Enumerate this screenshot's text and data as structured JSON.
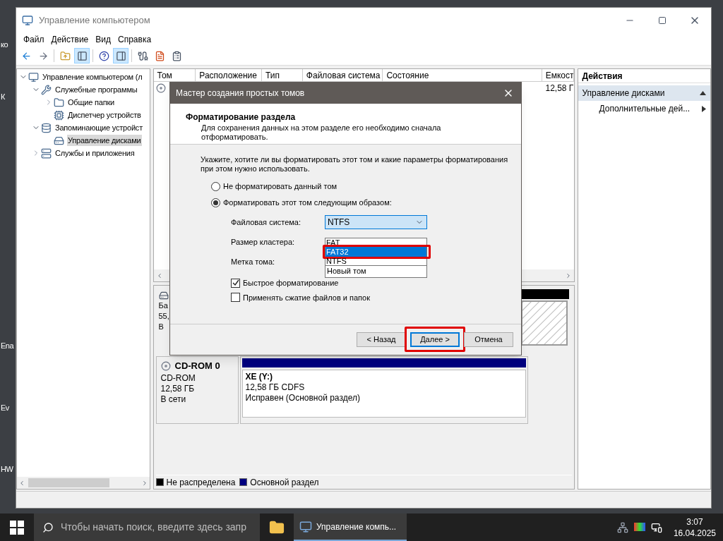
{
  "desktop": {
    "icon_labels": [
      "ко",
      "К",
      "Ena",
      "Ev",
      "HW"
    ]
  },
  "window": {
    "title": "Управление компьютером",
    "menu": [
      "Файл",
      "Действие",
      "Вид",
      "Справка"
    ],
    "toolbar": [
      {
        "kind": "back",
        "pressed": false
      },
      {
        "kind": "forward",
        "pressed": false
      },
      {
        "kind": "separator"
      },
      {
        "kind": "up",
        "pressed": false
      },
      {
        "kind": "tree",
        "pressed": true
      },
      {
        "kind": "separator"
      },
      {
        "kind": "help",
        "pressed": false
      },
      {
        "kind": "actions",
        "pressed": true
      },
      {
        "kind": "separator"
      },
      {
        "kind": "connect",
        "pressed": false
      },
      {
        "kind": "check",
        "pressed": false
      },
      {
        "kind": "list",
        "pressed": false
      }
    ],
    "tree": [
      {
        "label": "Управление компьютером (л",
        "kind": "computer",
        "expanded": true,
        "selected": false,
        "children": [
          {
            "label": "Служебные программы",
            "kind": "tools",
            "expanded": true,
            "selected": false,
            "children": [
              {
                "label": "Общие папки",
                "kind": "folder",
                "expanded": false,
                "selected": false
              },
              {
                "label": "Диспетчер устройств",
                "kind": "device",
                "selected": false
              }
            ]
          },
          {
            "label": "Запоминающие устройст",
            "kind": "storage",
            "expanded": true,
            "selected": false,
            "children": [
              {
                "label": "Управление дисками",
                "kind": "disk",
                "selected": true
              }
            ]
          },
          {
            "label": "Службы и приложения",
            "kind": "services",
            "expanded": false,
            "selected": false
          }
        ]
      }
    ],
    "volume_list": {
      "columns": [
        "Том",
        "Расположение",
        "Тип",
        "Файловая система",
        "Состояние",
        "Емкост"
      ],
      "rows": [
        {
          "capacity": "12,58 Г"
        }
      ]
    },
    "disks": [
      {
        "kind": "covered",
        "lines": [
          "Ба",
          "55,",
          "В"
        ]
      },
      {
        "kind": "full",
        "name": "CD-ROM 0",
        "lines": [
          "CD-ROM",
          "12,58 ГБ",
          "В сети"
        ],
        "partition": {
          "title": "XE  (Y:)",
          "lines": [
            "12,58 ГБ CDFS",
            "Исправен (Основной раздел)"
          ]
        }
      }
    ],
    "legend": [
      {
        "label": "Не распределена",
        "color": "#000000"
      },
      {
        "label": "Основной раздел",
        "color": "#000080"
      }
    ],
    "actions": {
      "header": "Действия",
      "items": [
        {
          "label": "Управление дисками",
          "kind": "section"
        },
        {
          "label": "Дополнительные дей...",
          "kind": "submenu"
        }
      ]
    }
  },
  "dialog": {
    "title": "Мастер создания простых томов",
    "heading": "Форматирование раздела",
    "subheading": "Для сохранения данных на этом разделе его необходимо сначала отформатировать.",
    "instruction": "Укажите, хотите ли вы форматировать этот том и какие параметры форматирования при этом нужно использовать.",
    "options": [
      {
        "label": "Не форматировать данный том",
        "selected": false
      },
      {
        "label": "Форматировать этот том следующим образом:",
        "selected": true
      }
    ],
    "fields": [
      {
        "label": "Файловая система:",
        "kind": "combo",
        "value": "NTFS"
      },
      {
        "label": "Размер кластера:",
        "kind": "covered"
      },
      {
        "label": "Метка тома:",
        "kind": "text",
        "value": "Новый том"
      }
    ],
    "dropdown": [
      {
        "label": "FAT",
        "selected": false,
        "highlighted": false
      },
      {
        "label": "FAT32",
        "selected": true,
        "highlighted": true
      },
      {
        "label": "NTFS",
        "selected": false,
        "highlighted": false
      }
    ],
    "checkboxes": [
      {
        "label": "Быстрое форматирование",
        "checked": true
      },
      {
        "label": "Применять сжатие файлов и папок",
        "checked": false
      }
    ],
    "buttons": [
      {
        "label": "< Назад",
        "focused": false,
        "highlighted": false
      },
      {
        "label": "Далее >",
        "focused": true,
        "highlighted": true
      },
      {
        "label": "Отмена",
        "focused": false,
        "highlighted": false
      }
    ]
  },
  "taskbar": {
    "search_placeholder": "Чтобы начать поиск, введите здесь запр",
    "app": "Управление компь...",
    "time": "3:07",
    "date": "16.04.2025"
  }
}
